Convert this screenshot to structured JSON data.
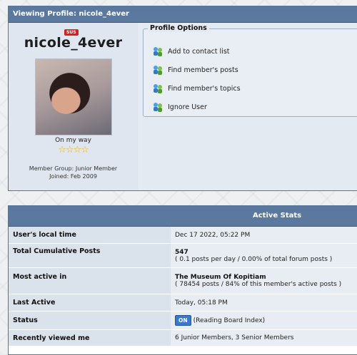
{
  "profile": {
    "header_title": "Viewing Profile: nicole_4ever",
    "badge": "SUS",
    "username": "nicole_4ever",
    "status_text": "On my way",
    "stars": "☆☆☆☆",
    "member_group": "Member Group: Junior Member",
    "joined": "Joined: Feb 2009"
  },
  "options": {
    "legend": "Profile Options",
    "items": [
      {
        "label": "Add to contact list",
        "icon": "contacts-icon"
      },
      {
        "label": "Find member's posts",
        "icon": "contacts-icon"
      },
      {
        "label": "Find member's topics",
        "icon": "contacts-icon"
      },
      {
        "label": "Ignore User",
        "icon": "contacts-icon"
      }
    ]
  },
  "stats": {
    "header": "Active Stats",
    "rows": [
      {
        "label": "User's local time",
        "value": "Dec 17 2022, 05:22 PM"
      },
      {
        "label": "Total Cumulative Posts",
        "value": "547",
        "sub": "( 0.1 posts per day / 0.00% of total forum posts )"
      },
      {
        "label": "Most active in",
        "value": "The Museum Of Kopitiam",
        "sub": "( 78454 posts / 84% of this member's active posts )"
      },
      {
        "label": "Last Active",
        "value": "Today, 05:18 PM"
      },
      {
        "label": "Status",
        "badge": "ON",
        "value": "(Reading Board Index)"
      },
      {
        "label": "Recently viewed me",
        "value": "6 Junior Members, 3 Senior Members"
      }
    ]
  },
  "colors": {
    "header_bg": "#5b799e",
    "badge_red": "#d42020",
    "on_blue": "#3d78c4"
  }
}
